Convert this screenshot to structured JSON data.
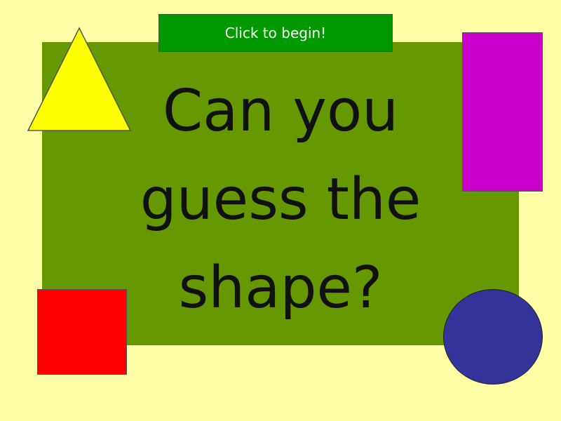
{
  "slide": {
    "title_lines": [
      "Can you",
      "guess the",
      "shape?"
    ],
    "begin_button_label": "Click to begin!"
  },
  "shapes": [
    {
      "name": "triangle",
      "color": "#ffff00"
    },
    {
      "name": "rectangle",
      "color": "#cc00cc"
    },
    {
      "name": "square",
      "color": "#ff0000"
    },
    {
      "name": "circle",
      "color": "#333399"
    }
  ],
  "colors": {
    "background": "#ffffa8",
    "panel": "#669900",
    "button": "#009900",
    "title_text": "#111111"
  }
}
